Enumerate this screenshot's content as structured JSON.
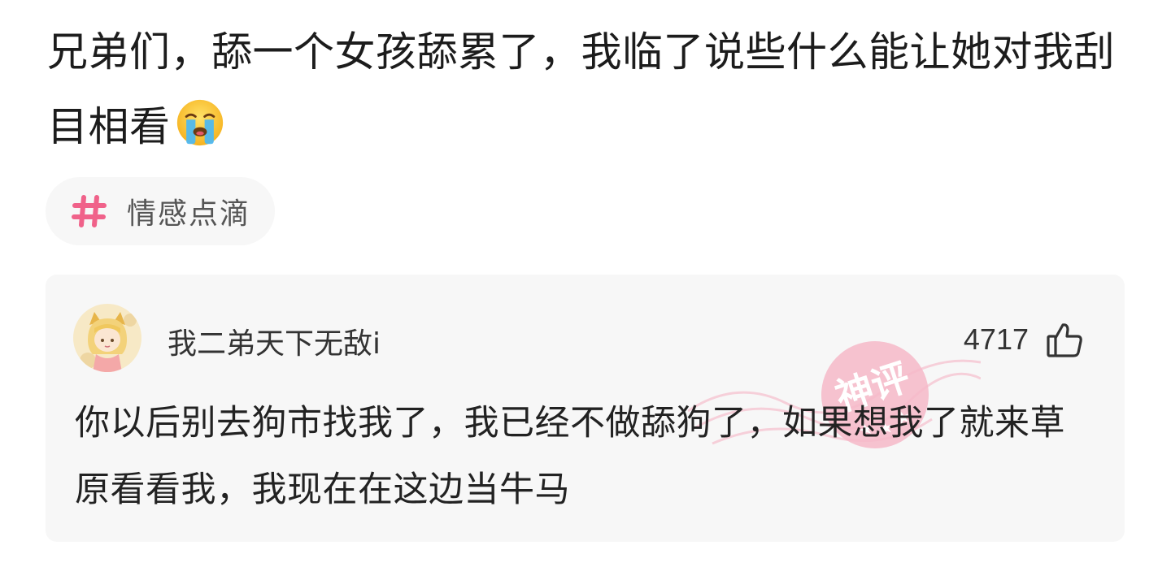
{
  "post": {
    "title": "兄弟们，舔一个女孩舔累了，我临了说些什么能让她对我刮目相看",
    "title_emoji": "loudly-crying-face-emoji"
  },
  "topic": {
    "icon": "hash-icon",
    "label": "情感点滴"
  },
  "comment": {
    "username": "我二弟天下无敌i",
    "like_count": "4717",
    "text": "你以后别去狗市找我了，我已经不做舔狗了，如果想我了就来草原看看我，我现在在这边当牛马",
    "stamp_label": "神评"
  },
  "colors": {
    "tag_accent": "#f0628a",
    "card_bg": "#f7f7f7",
    "stamp": "#f6b9c8"
  }
}
